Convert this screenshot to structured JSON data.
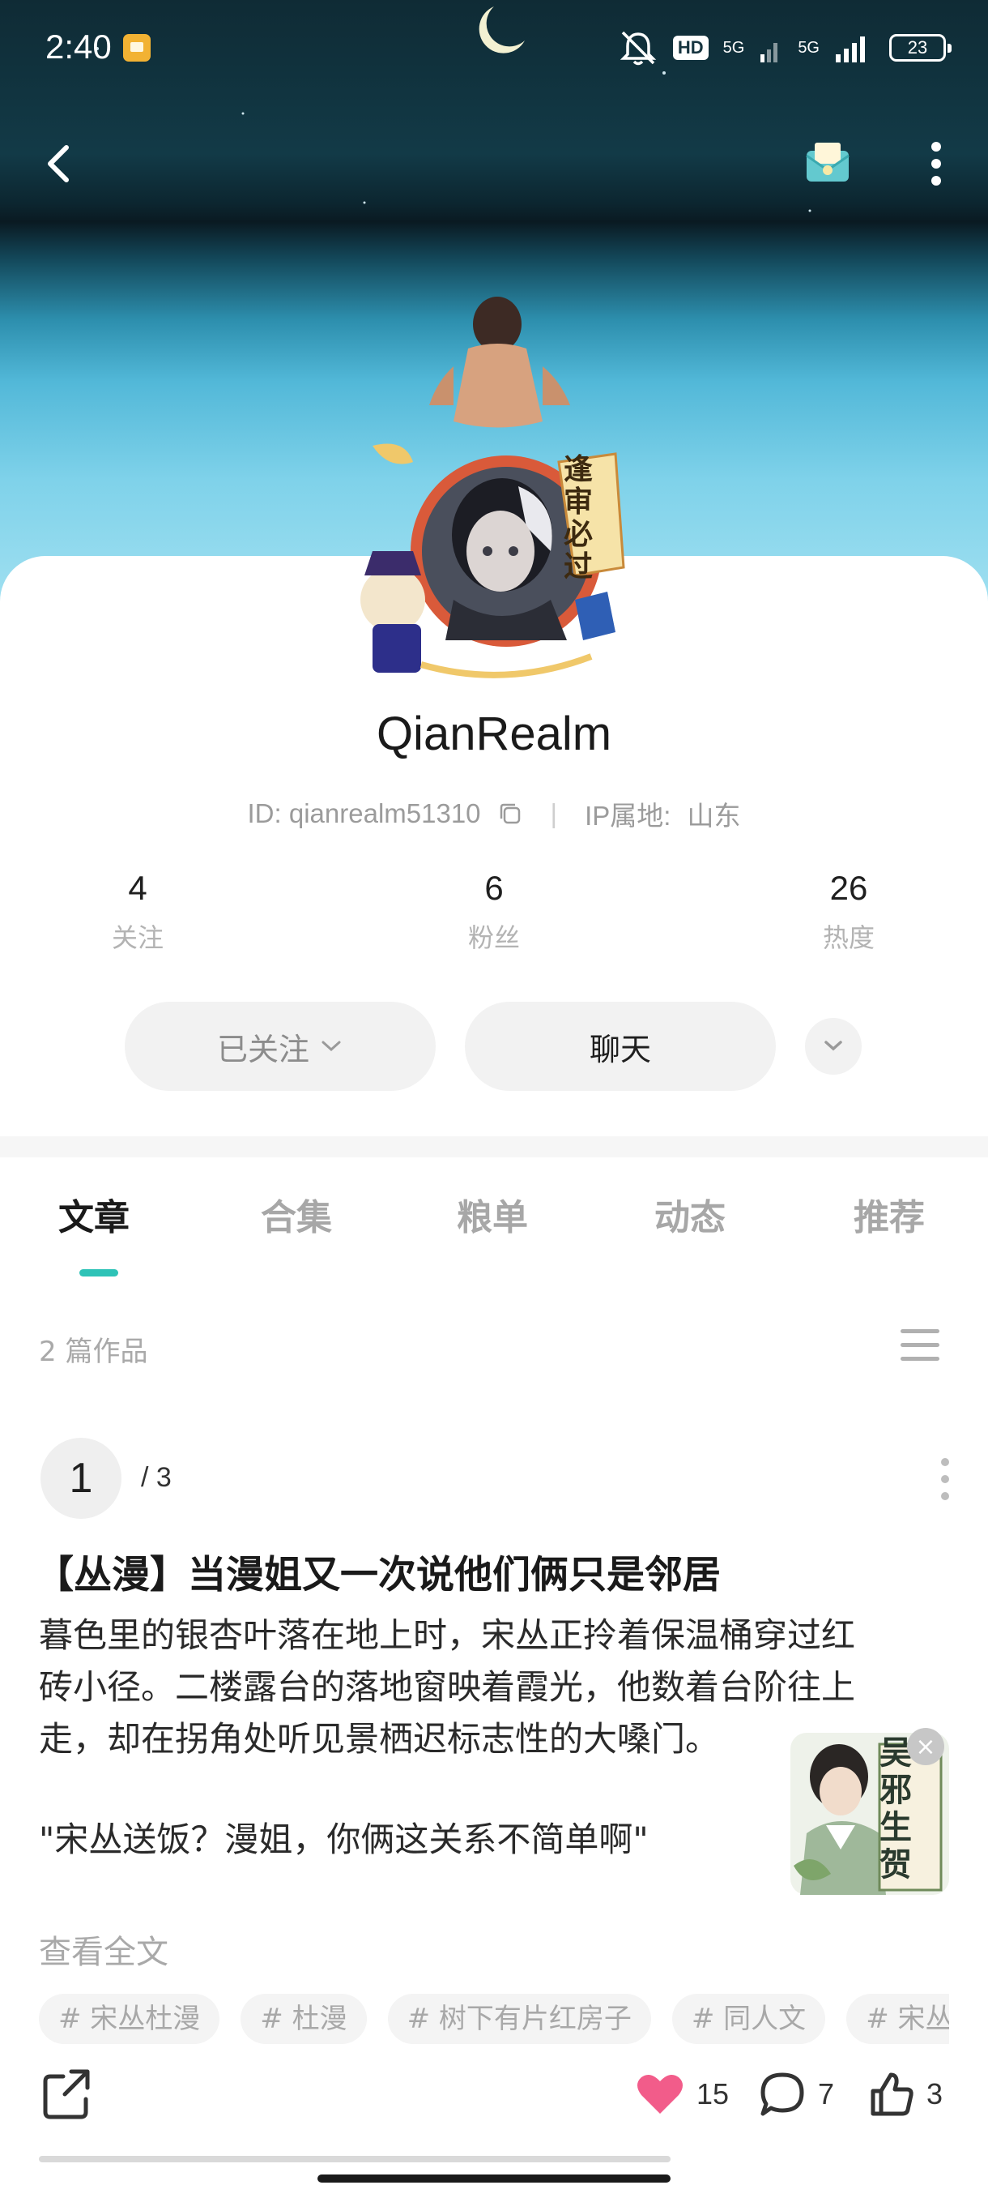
{
  "status_bar": {
    "time": "2:40",
    "hd_label": "HD",
    "network_1": "5G",
    "network_2": "5G",
    "battery": "23"
  },
  "profile": {
    "username": "QianRealm",
    "id_text": "ID: qianrealm51310",
    "ip_label": "IP属地:",
    "ip_value": "山东",
    "avatar_badge_text": "逢审必过",
    "stats": [
      {
        "value": "4",
        "label": "关注"
      },
      {
        "value": "6",
        "label": "粉丝"
      },
      {
        "value": "26",
        "label": "热度"
      }
    ],
    "follow_button": "已关注",
    "chat_button": "聊天"
  },
  "tabs": [
    {
      "label": "文章",
      "active": true
    },
    {
      "label": "合集",
      "active": false
    },
    {
      "label": "粮单",
      "active": false
    },
    {
      "label": "动态",
      "active": false
    },
    {
      "label": "推荐",
      "active": false
    }
  ],
  "works_count": "2 篇作品",
  "article": {
    "page": "1",
    "page_total": "/ 3",
    "title": "【丛漫】当漫姐又一次说他们俩只是邻居",
    "body_lines": [
      "暮色里的银杏叶落在地上时，宋丛正拎着保温桶穿过红",
      "砖小径。二楼露台的落地窗映着霞光，他数着台阶往上",
      "走，却在拐角处听见景栖迟标志性的大嗓门。"
    ],
    "quote": "\"宋丛送饭？漫姐，你俩这关系不简单啊\"",
    "read_more": "查看全文",
    "tags": [
      "# 宋丛杜漫",
      "# 杜漫",
      "# 树下有片红房子",
      "# 同人文",
      "# 宋丛"
    ],
    "likes": "15",
    "comments": "7",
    "thumbs": "3",
    "like_color": "#f25c8a"
  },
  "floating_widget": {
    "text": "吴邪生贺"
  },
  "colors": {
    "accent": "#2ec3b7",
    "muted": "#a9a9a9"
  }
}
